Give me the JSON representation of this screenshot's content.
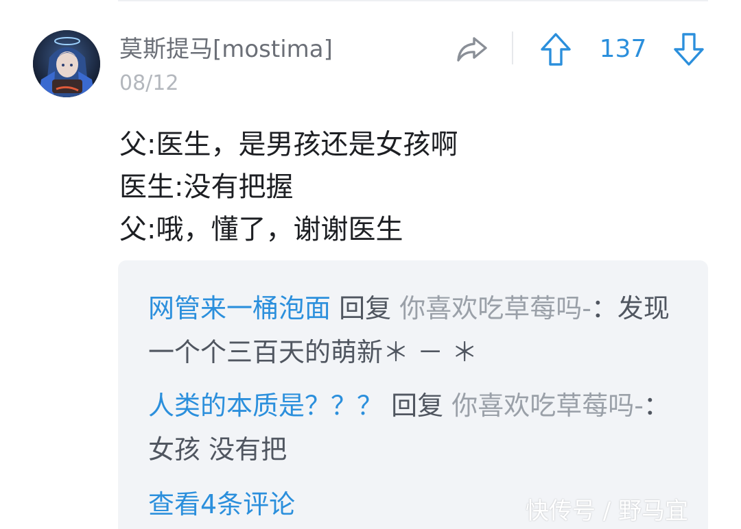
{
  "comment": {
    "username": "莫斯提马[mostima]",
    "date": "08/12",
    "vote_count": "137",
    "body_lines": [
      "父:医生，是男孩还是女孩啊",
      "医生:没有把握",
      "父:哦，懂了，谢谢医生"
    ]
  },
  "replies": [
    {
      "user": "网管来一桶泡面",
      "verb": " 回复 ",
      "target": "你喜欢吃草莓吗-",
      "text": "：发现一个个三百天的萌新＊ － ＊"
    },
    {
      "user": "人类的本质是？？？",
      "verb": " 回复 ",
      "target": "你喜欢吃草莓吗-",
      "text": "：女孩 没有把"
    }
  ],
  "view_more_label": "查看4条评论",
  "watermark": "快传号 / 野马宜",
  "colors": {
    "accent": "#2b8fdc",
    "reply_bg": "#f2f4f7",
    "muted": "#b3b7bd"
  },
  "icons": [
    "share-icon",
    "upvote-arrow-icon",
    "downvote-arrow-icon"
  ]
}
